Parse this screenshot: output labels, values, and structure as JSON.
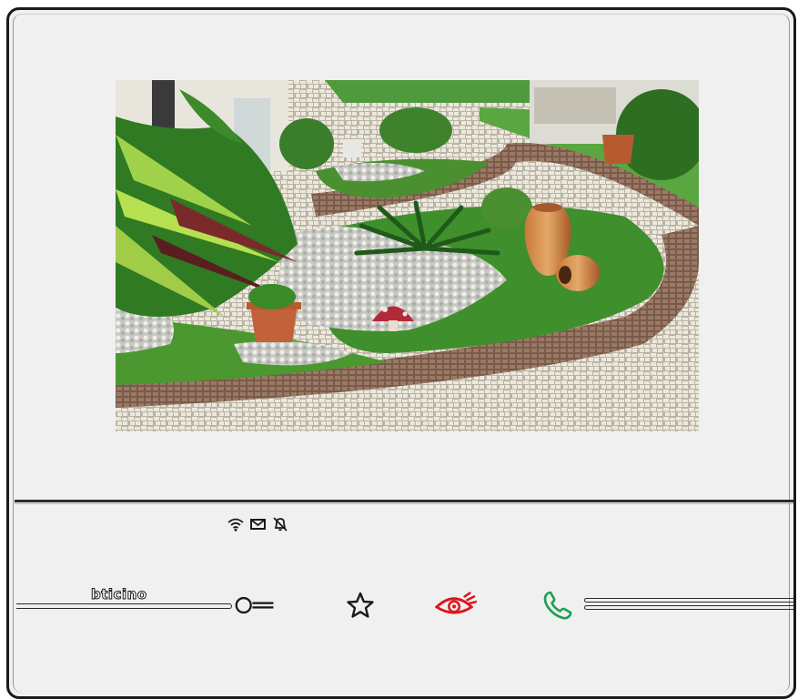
{
  "device": {
    "brand": "bticino",
    "screen_image": "garden-path-camera-feed"
  },
  "status_icons": [
    {
      "icon": "wifi-icon"
    },
    {
      "icon": "envelope-icon"
    },
    {
      "icon": "bell-off-icon"
    }
  ],
  "buttons": [
    {
      "icon": "key-icon",
      "color": "#1a1a1a"
    },
    {
      "icon": "star-icon",
      "color": "#1a1a1a"
    },
    {
      "icon": "eye-icon",
      "color": "#e0141e"
    },
    {
      "icon": "phone-icon",
      "color": "#1aa050"
    }
  ]
}
